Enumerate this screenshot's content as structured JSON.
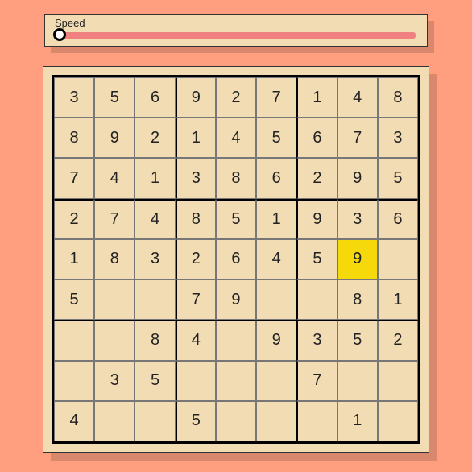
{
  "speed": {
    "label": "Speed",
    "value": 0,
    "min": 0,
    "max": 100
  },
  "sudoku": {
    "highlight": {
      "row": 4,
      "col": 7
    },
    "cells": [
      [
        "3",
        "5",
        "6",
        "9",
        "2",
        "7",
        "1",
        "4",
        "8"
      ],
      [
        "8",
        "9",
        "2",
        "1",
        "4",
        "5",
        "6",
        "7",
        "3"
      ],
      [
        "7",
        "4",
        "1",
        "3",
        "8",
        "6",
        "2",
        "9",
        "5"
      ],
      [
        "2",
        "7",
        "4",
        "8",
        "5",
        "1",
        "9",
        "3",
        "6"
      ],
      [
        "1",
        "8",
        "3",
        "2",
        "6",
        "4",
        "5",
        "9",
        ""
      ],
      [
        "5",
        "",
        "",
        "7",
        "9",
        "",
        "",
        "8",
        "1"
      ],
      [
        "",
        "",
        "8",
        "4",
        "",
        "9",
        "3",
        "5",
        "2"
      ],
      [
        "",
        "3",
        "5",
        "",
        "",
        "",
        "7",
        "",
        ""
      ],
      [
        "4",
        "",
        "",
        "5",
        "",
        "",
        "",
        "1",
        ""
      ]
    ]
  }
}
